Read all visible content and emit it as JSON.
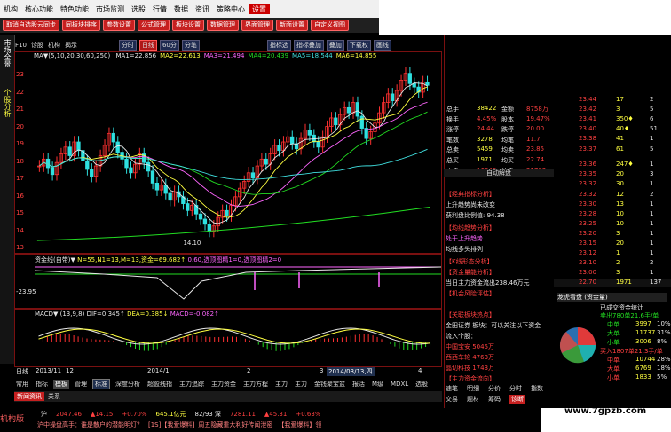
{
  "menu": [
    "机构",
    "核心功能",
    "特色功能",
    "市场监测",
    "选股",
    "行情",
    "数据",
    "资讯",
    "策略中心",
    "设置"
  ],
  "menu_active": "设置",
  "toolbar_buttons": [
    "取消自选股云同步",
    "同板块排序",
    "参数设置",
    "公式管理",
    "板块设置",
    "数据管理",
    "界面管理",
    "新面设置",
    "自定义视图"
  ],
  "side_tabs": [
    "市场全景",
    "个股分析"
  ],
  "chart_toolbar": {
    "left": [
      "F10",
      "诊股",
      "机构",
      "揭示"
    ],
    "periods": [
      "分时",
      "日线",
      "60分",
      "分笔"
    ],
    "active_period": "日线",
    "right": [
      "指标选",
      "指标叠加",
      "叠加",
      "下载权",
      "画线"
    ]
  },
  "ma_line": {
    "head": "MA▼(5,10,20,30,60,250)",
    "items": [
      {
        "text": "MA1=22.856",
        "color": "#e8e8e8"
      },
      {
        "text": "MA2=22.613",
        "color": "#ffff40"
      },
      {
        "text": "MA3=21.494",
        "color": "#ff66ff"
      },
      {
        "text": "MA4=20.439",
        "color": "#22dd22"
      },
      {
        "text": "MA5=18.544",
        "color": "#40e0e0"
      },
      {
        "text": "MA6=14.855",
        "color": "#ffff40"
      }
    ]
  },
  "y_ticks": [
    "23",
    "22",
    "21",
    "20",
    "19",
    "18",
    "17",
    "16",
    "15",
    "14",
    "13"
  ],
  "low_label": "14.10",
  "panel2": {
    "label": "资金线(自带)▼",
    "line": "N=55,N1=13,M=13,资金=69.682↑",
    "extra": "0.60,选顶图精1=0,选顶图精2=0",
    "left_val": "-23.95"
  },
  "panel3": {
    "label": "MACD▼",
    "params": "(13,9,8)",
    "dif": "DIF=0.345↑",
    "dea": "DEA=0.385↓",
    "macd": "MACD=-0.082↑"
  },
  "date_bar": [
    "日线",
    "2013/11",
    "12",
    "2014/1",
    "2",
    "3",
    "2014/03/13,四",
    "4"
  ],
  "bottom_tabs": [
    "常用",
    "指标",
    "模板",
    "管理",
    "标准",
    "深度分析",
    "超盈线指",
    "主力追踪",
    "主力资金",
    "主力方程",
    "主力",
    "主力",
    "金钱聚宝盆",
    "报活",
    "M级",
    "MDXL",
    "选股"
  ],
  "bottom_active": "模板",
  "news_bar": [
    "新闻资讯",
    "关系"
  ],
  "quote": [
    {
      "k": "总手",
      "v": "38422",
      "k2": "金额",
      "v2": "8758万"
    },
    {
      "k": "换手",
      "v": "4.45%",
      "k2": "股本",
      "v2": "19.47%"
    },
    {
      "k": "涨停",
      "v": "24.44",
      "k2": "跌停",
      "v2": "20.00"
    },
    {
      "k": "笔数",
      "v": "3278",
      "k2": "均笔",
      "v2": "11.7"
    },
    {
      "k": "总卖",
      "v": "5459",
      "k2": "均卖",
      "v2": "23.85"
    },
    {
      "k": "总买",
      "v": "1971",
      "k2": "均买",
      "v2": "22.74"
    },
    {
      "k": "内盘",
      "v": "16640",
      "k2": "外盘",
      "v2": "21782"
    }
  ],
  "f10_title": "自动解盘",
  "analysis": [
    {
      "t": "【经典指标分析】",
      "c": "#ff4040"
    },
    {
      "t": "上升趋势尚未改变",
      "c": "#e8e8e8"
    },
    {
      "t": "获利盘比例值: 94.38",
      "c": "#e8e8e8"
    },
    {
      "t": "【均线趋势分析】",
      "c": "#ff4040"
    },
    {
      "t": "处于上升趋势",
      "c": "#ff66ff"
    },
    {
      "t": "均线多头排列",
      "c": "#e8e8e8"
    },
    {
      "t": "【K线形态分析】",
      "c": "#ff4040"
    },
    {
      "t": "【资金量能分析】",
      "c": "#ff4040"
    },
    {
      "t": "当日主力资金流出238.46万元",
      "c": "#e8e8e8"
    },
    {
      "t": "【机会风险评估】",
      "c": "#ff4040"
    },
    {
      "t": "【关联板块热点】",
      "c": "#ff4040"
    },
    {
      "t": "金田证券 板块：可以关注以下资金",
      "c": "#e8e8e8"
    },
    {
      "t": "流入个股：",
      "c": "#e8e8e8"
    },
    {
      "t": "中国宝安 5045万",
      "c": "#ff4040"
    },
    {
      "t": "西西车轮 4763万",
      "c": "#ff4040"
    },
    {
      "t": "晶切科技 1743万",
      "c": "#ff4040"
    },
    {
      "t": "【主力资金流向】",
      "c": "#ff4040"
    }
  ],
  "right_tabs": [
    "速笔",
    "明细",
    "分价",
    "分时",
    "指数",
    "交易",
    "题材",
    "筹码",
    "诊断"
  ],
  "orders": [
    {
      "p": "23.44",
      "v": "17",
      "c": "2"
    },
    {
      "p": "23.42",
      "v": "3",
      "c": "5"
    },
    {
      "p": "23.41",
      "v": "350♦",
      "c": "6"
    },
    {
      "p": "23.40",
      "v": "40♦",
      "c": "51"
    },
    {
      "p": "23.38",
      "v": "41",
      "c": "1"
    },
    {
      "p": "23.37",
      "v": "61",
      "c": "5"
    },
    {
      "p": "23.36",
      "v": "247♦",
      "c": "1"
    },
    {
      "p": "23.35",
      "v": "20",
      "c": "3"
    },
    {
      "p": "23.32",
      "v": "30",
      "c": "1"
    },
    {
      "p": "23.32",
      "v": "12",
      "c": "2"
    },
    {
      "p": "23.30",
      "v": "13",
      "c": "1"
    },
    {
      "p": "23.28",
      "v": "10",
      "c": "1"
    },
    {
      "p": "23.25",
      "v": "10",
      "c": "1"
    },
    {
      "p": "23.20",
      "v": "3",
      "c": "1"
    },
    {
      "p": "23.15",
      "v": "20",
      "c": "1"
    },
    {
      "p": "23.12",
      "v": "1",
      "c": "1"
    },
    {
      "p": "23.10",
      "v": "2",
      "c": "2"
    },
    {
      "p": "23.00",
      "v": "3",
      "c": "1"
    },
    {
      "p": "22.70",
      "v": "1971",
      "c": "137"
    }
  ],
  "flow_header": "龙虎看盘 (资金量)",
  "flow": {
    "title": "已成交资金统计",
    "sell_total": "卖出780单21.6手/单",
    "sell": [
      [
        "中单",
        "3997",
        "10%"
      ],
      [
        "大单",
        "11737",
        "31%"
      ],
      [
        "小单",
        "3006",
        "8%"
      ]
    ],
    "buy_total": "买入1807单21.3手/单",
    "buy": [
      [
        "中单",
        "10744",
        "28%"
      ],
      [
        "大单",
        "6769",
        "18%"
      ],
      [
        "小单",
        "1833",
        "5%"
      ]
    ]
  },
  "ticker": [
    {
      "t": "沪",
      "c": "#e8e8e8"
    },
    {
      "t": "2047.46",
      "c": "#ff4040"
    },
    {
      "t": "▲14.15",
      "c": "#ff4040"
    },
    {
      "t": "+0.70%",
      "c": "#ff4040"
    },
    {
      "t": "645.1亿元",
      "c": "#ffff40"
    },
    {
      "t": "82/93 深",
      "c": "#e8e8e8"
    },
    {
      "t": "7281.11",
      "c": "#ff4040"
    },
    {
      "t": "▲45.31",
      "c": "#ff4040"
    },
    {
      "t": "+0.63%",
      "c": "#ff4040"
    }
  ],
  "newsline": [
    "沪中操盘高手：谁是散户的潜能明灯？",
    "[1S]【我爱爆料】周五隐藏重大利好传闻泄密",
    "【我爱爆料】领"
  ],
  "watermark": "www.7gpzb.com",
  "left_corner": "机构版"
}
